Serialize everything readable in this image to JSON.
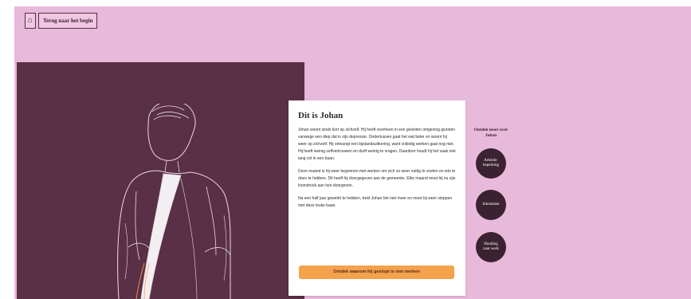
{
  "nav": {
    "home_icon": "home-icon",
    "back_label": "Terug naar het begin"
  },
  "card": {
    "title": "Dit is Johan",
    "paragraphs": [
      "Johan woont sinds kort op zichzelf. Hij heeft voorheen in een gesloten omgeving gezeten vanwege een diep dal in zijn depressie. Ondertussen gaat het wat beter en woont hij weer op zichzelf. Hij ontvangt een bijstandsuitkering, want volledig werken gaat nog niet. Hij heeft weinig zelfvertrouwen en durft weinig te vragen. Daardoor houdt hij het vaak niet lang vol in een baan.",
      "Deze maand is hij weer begonnen met werken om zich zo weer nuttig te voelen en iets te doen te hebben. Dit heeft hij doorgegeven aan de gemeente. Elke maand moet hij nu zijn loonstrook aan hen doorgeven.",
      "Na een half jaar gewerkt te hebben, trekt Johan het niet meer en moet hij weer stoppen met deze leuke baan."
    ],
    "cta_label": "Ontdek waarom hij gestopt is met werken"
  },
  "more": {
    "label": "Ontdek meer over\nJohan",
    "items": [
      {
        "label": "Arbeids-\nbeperking"
      },
      {
        "label": "Inkomsten"
      },
      {
        "label": "Houding\nnaar werk"
      }
    ]
  },
  "colors": {
    "page_bg": "#e7b9da",
    "panel_bg": "#5a3046",
    "cta_bg": "#f4a24c",
    "circle_bg": "#3b2230"
  }
}
